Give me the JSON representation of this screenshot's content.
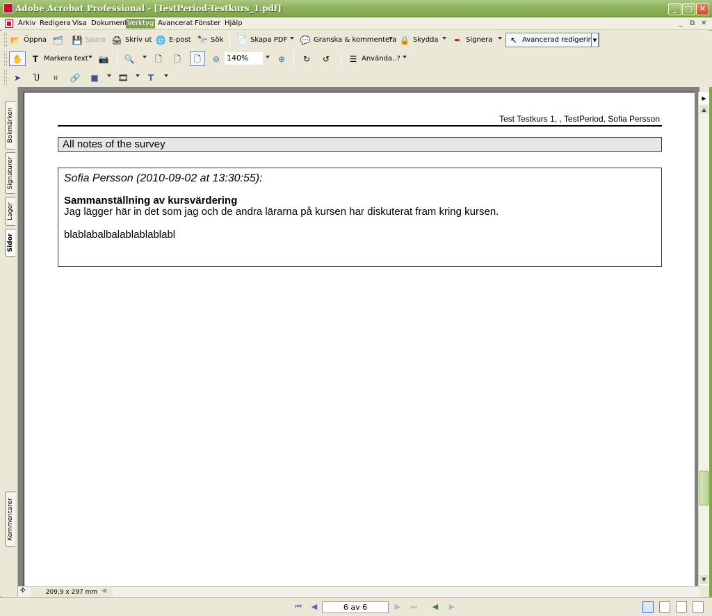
{
  "window": {
    "title": "Adobe Acrobat Professional - [TestPeriod-Testkurs_1.pdf]"
  },
  "menu": {
    "items": [
      {
        "label": "Arkiv"
      },
      {
        "label": "Redigera"
      },
      {
        "label": "Visa"
      },
      {
        "label": "Dokument"
      },
      {
        "label": "Verktyg",
        "active": true
      },
      {
        "label": "Avancerat"
      },
      {
        "label": "Fönster"
      },
      {
        "label": "Hjälp"
      }
    ]
  },
  "toolbar1": {
    "open": "Öppna",
    "save": "Spara",
    "print": "Skriv ut",
    "email": "E-post",
    "search": "Sök",
    "create_pdf": "Skapa PDF",
    "review": "Granska & kommentera",
    "secure": "Skydda",
    "sign": "Signera",
    "advanced_edit": "Avancerad redigering"
  },
  "toolbar2": {
    "select_text": "Markera text",
    "zoom": "140%",
    "use": "Använda..?"
  },
  "side_tabs": {
    "bookmarks": "Bokmärken",
    "signatures": "Signaturer",
    "layers": "Lager",
    "pages": "Sidor",
    "comments": "Kommentarer"
  },
  "document": {
    "header": "Test Testkurs 1, , TestPeriod, Sofia Persson",
    "section_title": "All notes of the survey",
    "note": {
      "author_line": "Sofia Persson (2010-09-02 at 13:30:55):",
      "subject": "Sammanställning av kursvärdering",
      "body": "Jag lägger här in det som jag och de andra lärarna på kursen har diskuterat fram kring kursen.",
      "extra": "blablabalbalablablablabl"
    }
  },
  "status": {
    "page_size": "209,9 x 297 mm",
    "page_indicator": "6 av 6"
  },
  "colors": {
    "titlebar": "#8fb35c",
    "menu_active": "#7e9d53",
    "section_bg": "#e6e6e6"
  }
}
